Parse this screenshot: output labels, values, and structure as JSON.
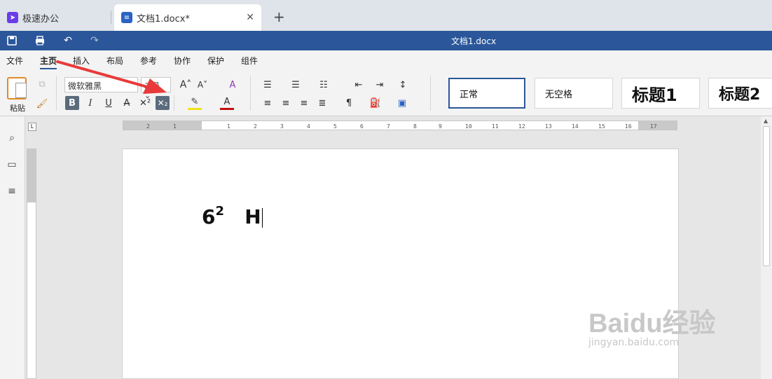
{
  "tabs": {
    "home_label": "极速办公",
    "doc_label": "文档1.docx*",
    "close_symbol": "✕",
    "new_tab_symbol": "+"
  },
  "titlebar": {
    "title": "文档1.docx"
  },
  "menu": {
    "items": [
      "文件",
      "主页",
      "插入",
      "布局",
      "参考",
      "协作",
      "保护",
      "组件"
    ],
    "active": "主页"
  },
  "ribbon": {
    "paste_label": "粘贴",
    "font_name": "微软雅黑",
    "font_size": "二号",
    "style_cards": [
      "正常",
      "无空格",
      "标题1",
      "标题2"
    ]
  },
  "ruler": {
    "tab_marker": "L",
    "ticks": [
      "2",
      "1",
      "1",
      "2",
      "3",
      "4",
      "5",
      "6",
      "7",
      "8",
      "9",
      "10",
      "11",
      "12",
      "13",
      "14",
      "15",
      "16",
      "17"
    ]
  },
  "document": {
    "base": "6",
    "superscript": "2",
    "letter": "H"
  },
  "watermark": {
    "brand": "Baidu经验",
    "url": "jingyan.baidu.com"
  },
  "colors": {
    "titlebar": "#2b579a",
    "arrow": "#e83a3a",
    "active_button": "#5b6b7c"
  }
}
